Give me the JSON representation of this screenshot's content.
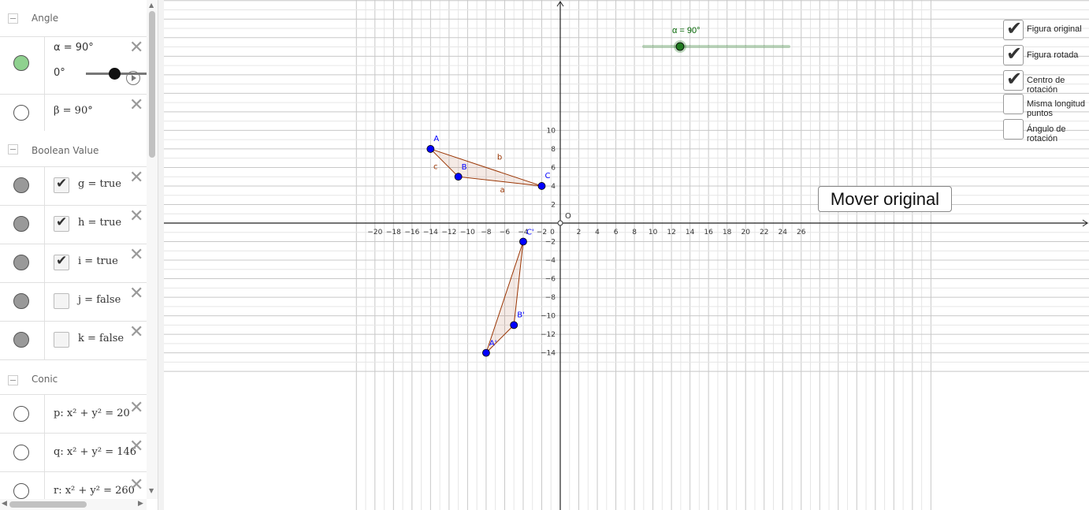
{
  "algebra": {
    "categories": {
      "angle": "Angle",
      "boolean": "Boolean Value",
      "conic": "Conic"
    },
    "items": {
      "alpha": {
        "def": "α = 90°",
        "slider_min": "0°",
        "marble_color": "#8fd18f"
      },
      "beta": {
        "def": "β = 90°"
      },
      "g": {
        "def": "g = true",
        "checked": true
      },
      "h": {
        "def": "h = true",
        "checked": true
      },
      "i": {
        "def": "i = true",
        "checked": true
      },
      "j": {
        "def": "j = false",
        "checked": false
      },
      "k": {
        "def": "k = false",
        "checked": false
      },
      "p": {
        "def": "p: x² + y² = 20"
      },
      "q": {
        "def": "q: x² + y² = 146"
      },
      "r": {
        "def": "r: x² + y² = 260"
      }
    },
    "slider_value_fraction": 0.5
  },
  "graphics": {
    "slider": {
      "label": "α = 90°",
      "color": "#006400",
      "value_fraction": 0.25
    },
    "checkboxes": [
      {
        "label": "Figura original",
        "checked": true
      },
      {
        "label": "Figura rotada",
        "checked": true
      },
      {
        "label": "Centro de rotación",
        "checked": true
      },
      {
        "label": "Misma longitud puntos",
        "checked": false
      },
      {
        "label": "Ángulo de rotación",
        "checked": false
      }
    ],
    "button_label": "Mover original",
    "origin_label": "O",
    "x_ticks": [
      "−20",
      "−18",
      "−16",
      "−14",
      "−12",
      "−10",
      "−8",
      "−6",
      "−4",
      "−2",
      "0",
      "2",
      "4",
      "6",
      "8",
      "10",
      "12",
      "14",
      "16",
      "18",
      "20",
      "22",
      "24",
      "26"
    ],
    "y_ticks_pos": [
      "10",
      "8",
      "6",
      "4",
      "2"
    ],
    "y_ticks_neg": [
      "−2",
      "−4",
      "−6",
      "−8",
      "−10",
      "−12",
      "−14"
    ],
    "points": {
      "A": {
        "label": "A",
        "x": -14,
        "y": 8
      },
      "B": {
        "label": "B",
        "x": -11,
        "y": 5
      },
      "C": {
        "label": "C",
        "x": -2,
        "y": 4
      },
      "A1": {
        "label": "A'",
        "x": -8,
        "y": -14
      },
      "B1": {
        "label": "B'",
        "x": -5,
        "y": -11
      },
      "C1": {
        "label": "C'",
        "x": -4,
        "y": -2
      }
    },
    "segment_labels": {
      "a": "a",
      "b": "b",
      "c": "c"
    },
    "colors": {
      "point": "#0000ff",
      "polygon_stroke": "#993300",
      "polygon_fill": "#993300",
      "segment_label": "#993300"
    }
  }
}
